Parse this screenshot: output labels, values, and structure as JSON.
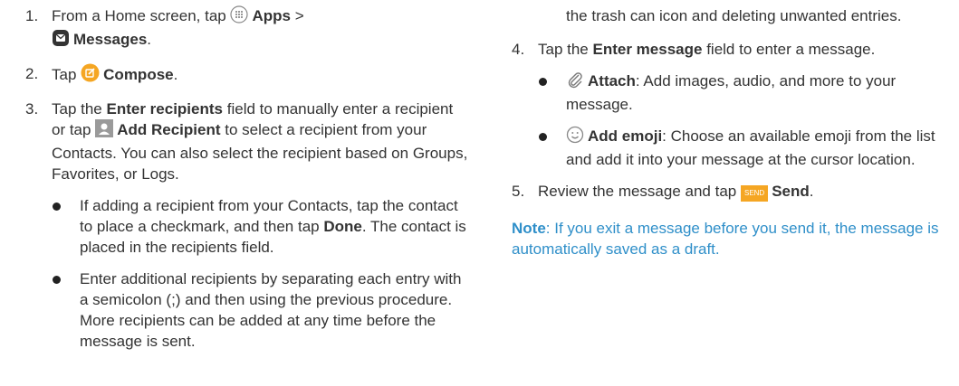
{
  "left": {
    "step1": {
      "num": "1.",
      "pre": "From a Home screen, tap",
      "apps": "Apps",
      "gt": ">",
      "messages": "Messages",
      "end": "."
    },
    "step2": {
      "num": "2.",
      "pre": "Tap",
      "compose": "Compose",
      "end": "."
    },
    "step3": {
      "num": "3.",
      "pre": "Tap the",
      "field": "Enter recipients",
      "mid": "field to manually enter a recipient or tap",
      "add": "Add Recipient",
      "post": "to select a recipient from your Contacts. You can also select the recipient based on Groups, Favorites, or Logs."
    },
    "bullet1": {
      "pre": "If adding a recipient from your Contacts, tap the contact to place a checkmark, and then tap",
      "done": "Done",
      "post": ". The contact is placed in the recipients field."
    },
    "bullet2": {
      "text": "Enter additional recipients by separating each entry with a semicolon (;) and then using the previous procedure. More recipients can be added at any time before the message is sent."
    }
  },
  "right": {
    "cont": "the trash can icon and deleting unwanted entries.",
    "step4": {
      "num": "4.",
      "pre": "Tap the",
      "field": "Enter message",
      "post": "field to enter a message."
    },
    "attach": {
      "label": "Attach",
      "text": ": Add images, audio, and more to your message."
    },
    "emoji": {
      "label": "Add emoji",
      "text": ": Choose an available emoji from the list and add it into your message at the cursor location."
    },
    "step5": {
      "num": "5.",
      "pre": "Review the message and tap",
      "send_icon": "SEND",
      "send": "Send",
      "end": "."
    },
    "note": {
      "label": "Note",
      "text": ": If you exit a message before you send it, the message is automatically saved as a draft."
    }
  },
  "icons": {
    "apps": "apps-grid-icon",
    "messages": "messages-icon",
    "compose": "compose-icon",
    "add_recipient": "contact-icon",
    "attach": "paperclip-icon",
    "emoji": "smiley-icon",
    "send": "send-icon"
  },
  "colors": {
    "text": "#333333",
    "note": "#2f8fc9",
    "accent_orange": "#f5a623"
  }
}
